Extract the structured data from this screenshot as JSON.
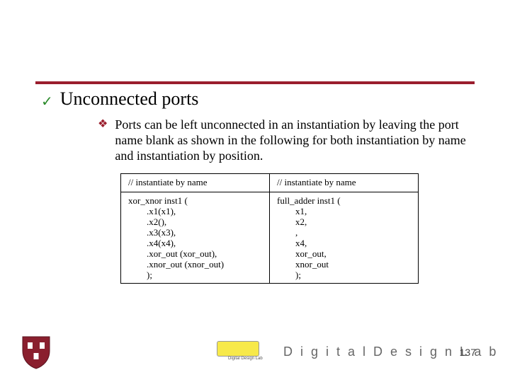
{
  "heading": {
    "check_glyph": "✓",
    "text": "Unconnected ports"
  },
  "bullet": {
    "diamond_glyph": "❖",
    "text": "Ports can be left unconnected in an instantiation by leaving the port name blank as shown in the following for both instantiation by name and instantiation by position."
  },
  "table": {
    "col1": {
      "header": "// instantiate by name",
      "l0": "xor_xnor inst1 (",
      "l1": "        .x1(x1),",
      "l2": "        .x2(),",
      "l3": "        .x3(x3),",
      "l4": "        .x4(x4),",
      "l5": "        .xor_out (xor_out),",
      "l6": "        .xnor_out (xnor_out)",
      "l7": "        );"
    },
    "col2": {
      "header": "// instantiate by name",
      "l0": "full_adder inst1 (",
      "l1": "        x1,",
      "l2": "        x2,",
      "l3": "        ,",
      "l4": "        x4,",
      "l5": "        xor_out,",
      "l6": "        xnor_out",
      "l7": "        );"
    }
  },
  "footer": {
    "logo_caption": "Digital Design Lab",
    "lab_text": "D i g i t a l   D e s i g n   L a b",
    "page_number": "137"
  }
}
